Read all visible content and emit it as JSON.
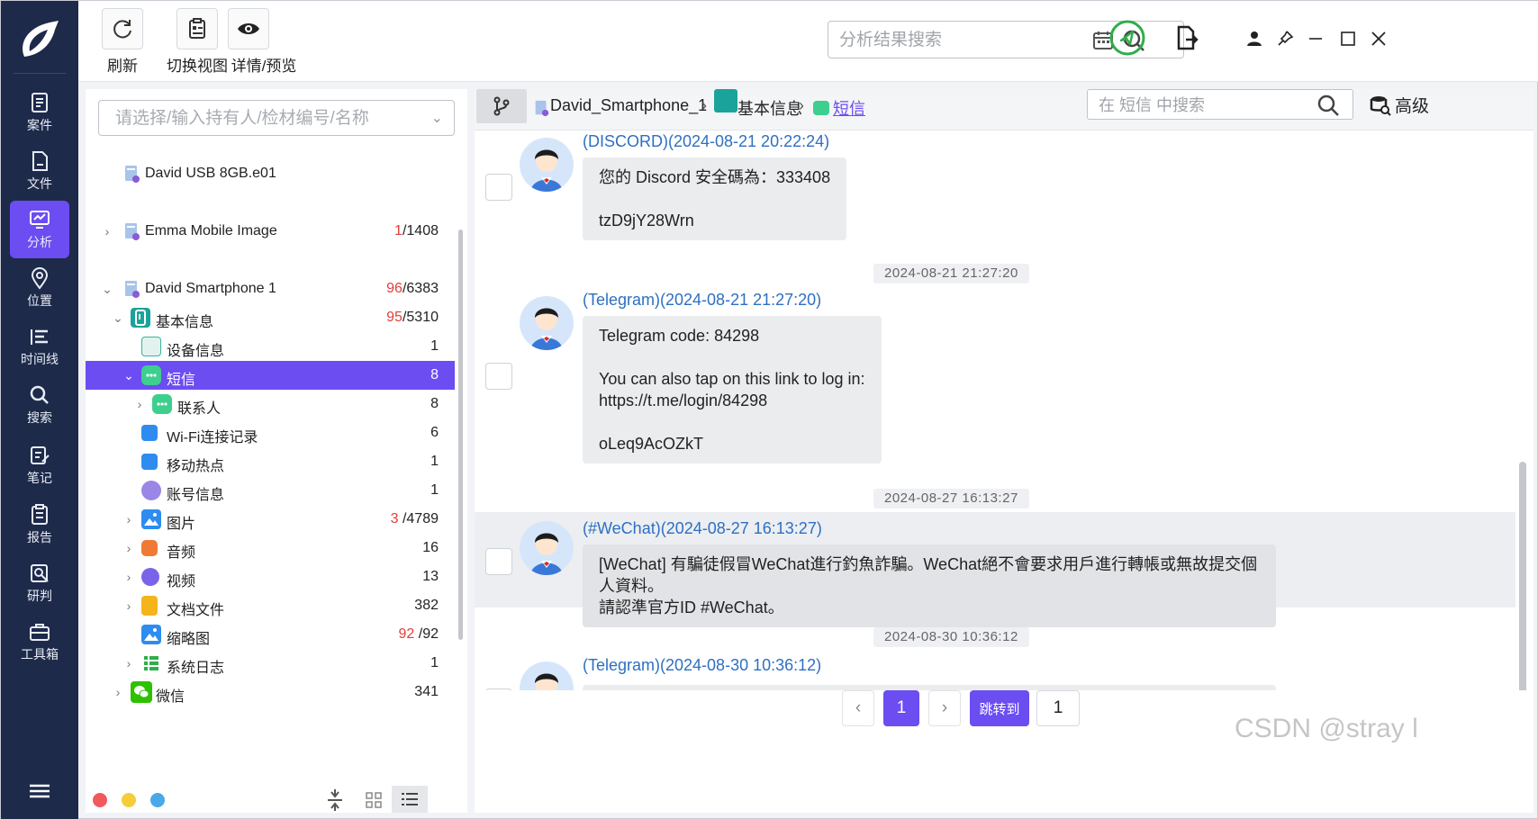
{
  "nav": {
    "items": [
      {
        "label": "案件",
        "icon": "case-icon"
      },
      {
        "label": "文件",
        "icon": "file-icon"
      },
      {
        "label": "分析",
        "icon": "analysis-icon",
        "active": true
      },
      {
        "label": "位置",
        "icon": "location-icon"
      },
      {
        "label": "时间线",
        "icon": "timeline-icon"
      },
      {
        "label": "搜索",
        "icon": "search-icon"
      },
      {
        "label": "笔记",
        "icon": "note-icon"
      },
      {
        "label": "报告",
        "icon": "report-icon"
      },
      {
        "label": "研判",
        "icon": "judge-icon"
      },
      {
        "label": "工具箱",
        "icon": "toolbox-icon"
      }
    ]
  },
  "toolbar": {
    "refresh_label": "刷新",
    "switch_view_label": "切换视图",
    "details_label": "详情/预览",
    "search_placeholder": "分析结果搜索"
  },
  "tree": {
    "placeholder": "请选择/输入持有人/检材编号/名称",
    "rows": [
      {
        "label": "David USB 8GB.e01",
        "count": ""
      },
      {
        "label": "Emma Mobile Image",
        "count_red": "1",
        "count": "/1408"
      },
      {
        "label": "David Smartphone 1",
        "count_red": "96",
        "count": "/6383"
      },
      {
        "label": "基本信息",
        "count_red": "95",
        "count": "/5310"
      },
      {
        "label": "设备信息",
        "count": "1"
      },
      {
        "label": "短信",
        "count": "8"
      },
      {
        "label": "联系人",
        "count": "8"
      },
      {
        "label": "Wi-Fi连接记录",
        "count": "6"
      },
      {
        "label": "移动热点",
        "count": "1"
      },
      {
        "label": "账号信息",
        "count": "1"
      },
      {
        "label": "图片",
        "count_red": "3",
        "count": " /4789"
      },
      {
        "label": "音频",
        "count": "16"
      },
      {
        "label": "视频",
        "count": "13"
      },
      {
        "label": "文档文件",
        "count": "382"
      },
      {
        "label": "缩略图",
        "count_red": "92",
        "count": " /92"
      },
      {
        "label": "系统日志",
        "count": "1"
      },
      {
        "label": "微信",
        "count": "341"
      }
    ]
  },
  "breadcrumb": {
    "device": "David_Smartphone_1",
    "category": "基本信息",
    "current": "短信",
    "sep": "›"
  },
  "msg_search": {
    "placeholder": "在 短信 中搜索"
  },
  "advanced_label": "高级",
  "messages": [
    {
      "head": "(DISCORD)(2024-08-21 20:22:24)",
      "body": "您的 Discord 安全碼為：333408\n\ntzD9jY28Wrn"
    },
    {
      "ts": "2024-08-21 21:27:20",
      "head": "(Telegram)(2024-08-21 21:27:20)",
      "body": "Telegram code: 84298\n\nYou can also tap on this link to log in:\nhttps://t.me/login/84298\n\noLeq9AcOZkT"
    },
    {
      "ts": "2024-08-27 16:13:27",
      "head": "(#WeChat)(2024-08-27 16:13:27)",
      "body": "[WeChat] 有騙徒假冒WeChat進行釣魚詐騙。WeChat絕不會要求用戶進行轉帳或無故提交個人資料。\n請認準官方ID #WeChat。"
    },
    {
      "ts": "2024-08-30 10:36:12",
      "head": "(Telegram)(2024-08-30 10:36:12)",
      "body": ""
    }
  ],
  "pager": {
    "prev": "‹",
    "page": "1",
    "next": "›",
    "jump_label": "跳转到",
    "jump_value": "1"
  },
  "watermark": "CSDN @stray l",
  "colors": {
    "nav_bg": "#1e2a4a",
    "accent": "#6b4df2",
    "link": "#2e6fc2",
    "count_red": "#e0403a"
  }
}
